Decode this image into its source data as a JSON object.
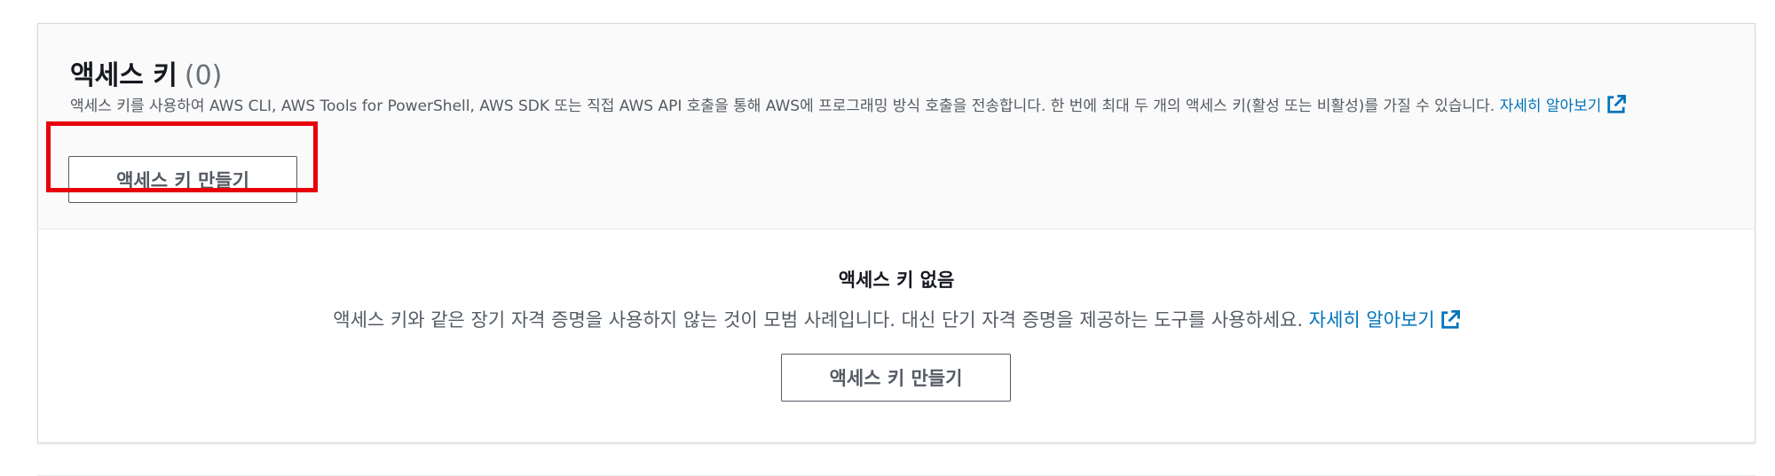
{
  "access_keys": {
    "title": "액세스 키",
    "count": "(0)",
    "description": "액세스 키를 사용하여 AWS CLI, AWS Tools for PowerShell, AWS SDK 또는 직접 AWS API 호출을 통해 AWS에 프로그래밍 방식 호출을 전송합니다. 한 번에 최대 두 개의 액세스 키(활성 또는 비활성)를 가질 수 있습니다.",
    "learn_more": "자세히 알아보기",
    "create_button": "액세스 키 만들기"
  },
  "empty_state": {
    "title": "액세스 키 없음",
    "description": "액세스 키와 같은 장기 자격 증명을 사용하지 않는 것이 모범 사례입니다. 대신 단기 자격 증명을 제공하는 도구를 사용하세요.",
    "learn_more": "자세히 알아보기",
    "create_button": "액세스 키 만들기"
  },
  "icons": {
    "external_link": "external-link-icon"
  },
  "colors": {
    "link": "#0073bb",
    "highlight": "#e8000b"
  }
}
